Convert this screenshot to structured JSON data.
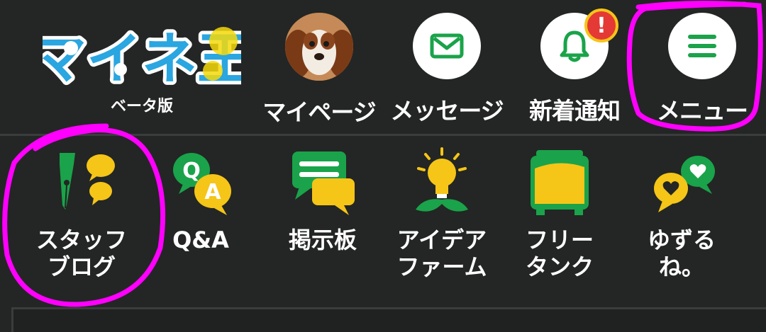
{
  "header": {
    "logo_text": "マイネ王",
    "logo_sub": "ベータ版",
    "nav": [
      {
        "id": "mypage",
        "label": "マイページ",
        "icon": "avatar-dog"
      },
      {
        "id": "message",
        "label": "メッセージ",
        "icon": "envelope-icon"
      },
      {
        "id": "notify",
        "label": "新着通知",
        "icon": "bell-icon",
        "badge": "!"
      },
      {
        "id": "menu",
        "label": "メニュー",
        "icon": "hamburger-icon"
      }
    ]
  },
  "categories": [
    {
      "id": "staff-blog",
      "label": "スタッフ\nブログ",
      "icon": "pen-chat-icon"
    },
    {
      "id": "qa",
      "label": "Q&A",
      "icon": "qa-bubbles-icon"
    },
    {
      "id": "board",
      "label": "掲示板",
      "icon": "board-bubbles-icon"
    },
    {
      "id": "idea-farm",
      "label": "アイデア\nファーム",
      "icon": "lightbulb-icon"
    },
    {
      "id": "free-tank",
      "label": "フリー\nタンク",
      "icon": "tank-icon"
    },
    {
      "id": "yuzurune",
      "label": "ゆずるね。",
      "icon": "heart-bubbles-icon"
    }
  ],
  "colors": {
    "background": "#232624",
    "green": "#1aa34a",
    "yellow": "#f5c518",
    "annotation": "#ff00ff"
  }
}
